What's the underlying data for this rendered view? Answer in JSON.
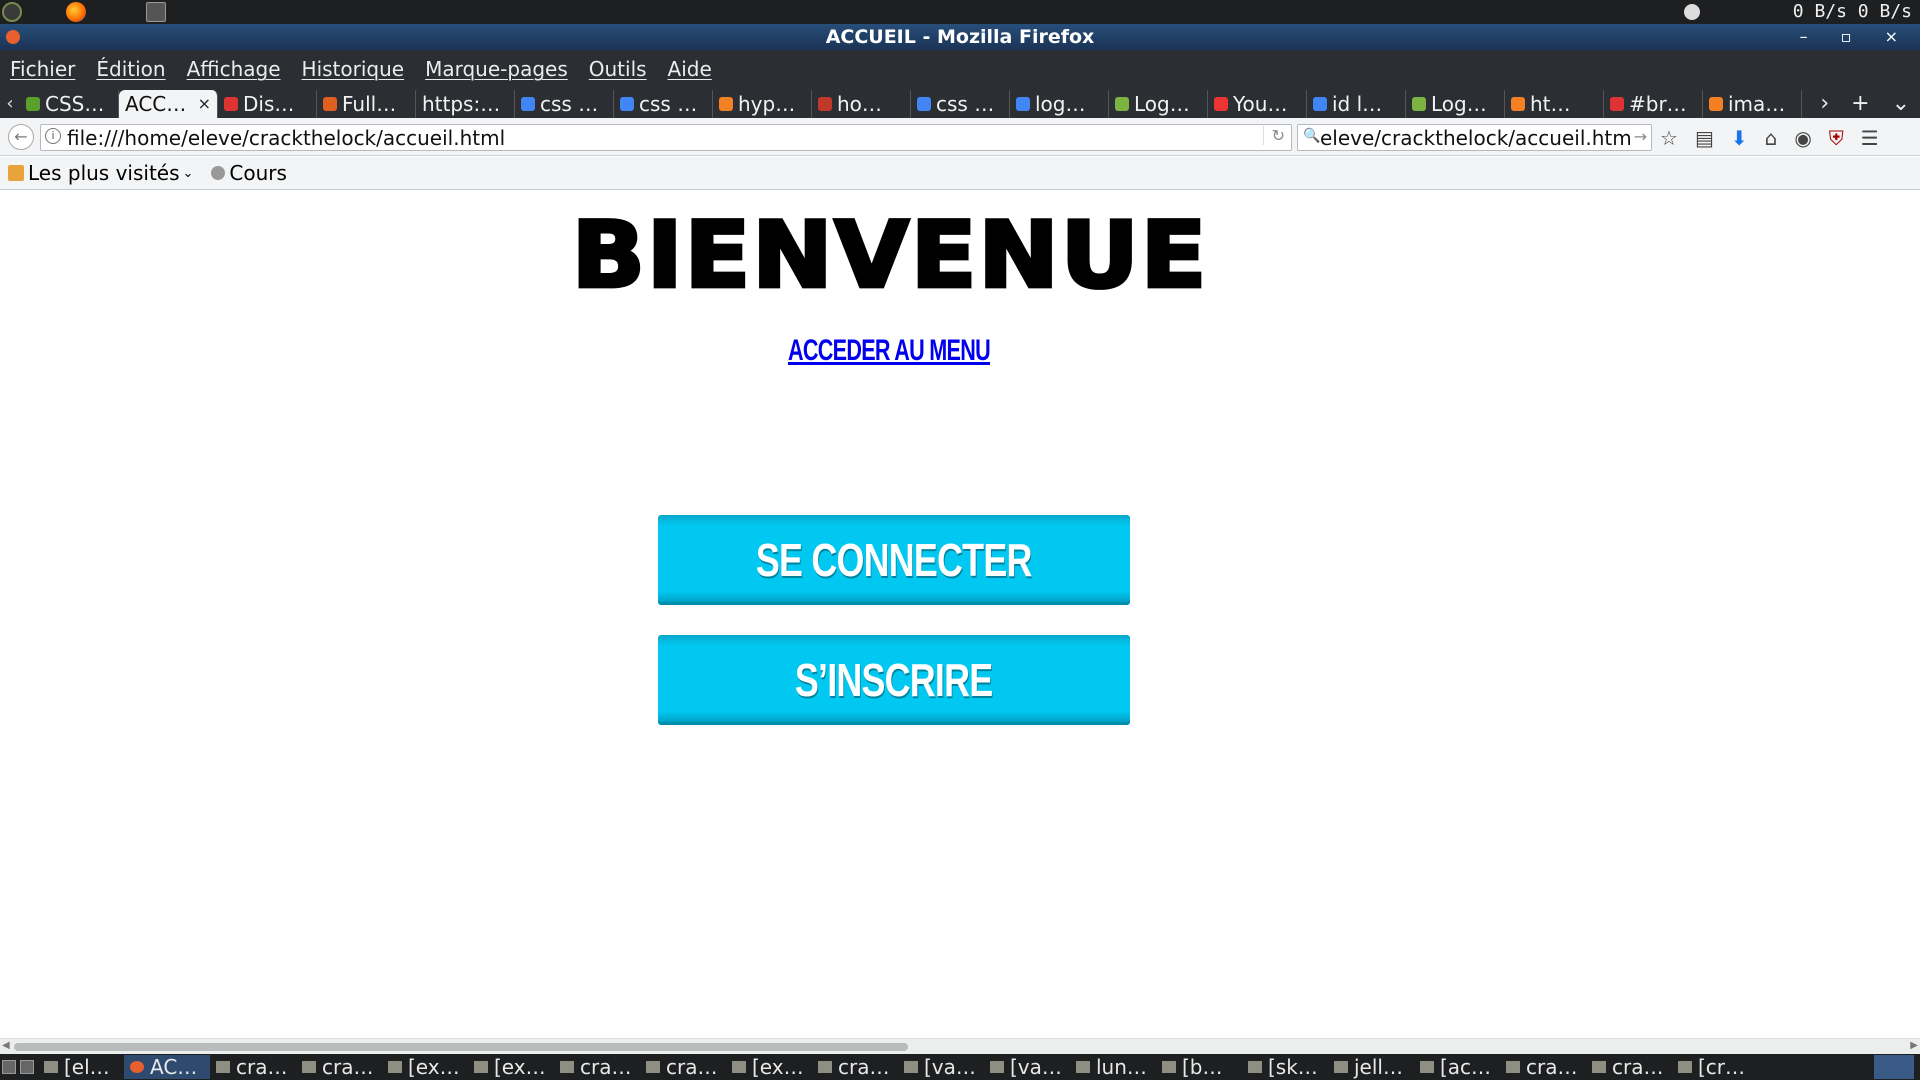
{
  "system_bar": {
    "tray_text": "0 B/s 0 B/s"
  },
  "window": {
    "title": "ACCUEIL - Mozilla Firefox",
    "controls": "– ▫ ×"
  },
  "menubar": {
    "items": [
      "Fichier",
      "Édition",
      "Affichage",
      "Historique",
      "Marque-pages",
      "Outils",
      "Aide"
    ]
  },
  "tabs": [
    {
      "label": "CSS…",
      "color": "#5aa02c",
      "active": false
    },
    {
      "label": "ACC…",
      "color": "",
      "active": true
    },
    {
      "label": "Dis…",
      "color": "#d33",
      "active": false
    },
    {
      "label": "Full…",
      "color": "#e06020",
      "active": false
    },
    {
      "label": "https:…",
      "color": "",
      "active": false
    },
    {
      "label": "css …",
      "color": "#4285f4",
      "active": false
    },
    {
      "label": "css …",
      "color": "#4285f4",
      "active": false
    },
    {
      "label": "hyp…",
      "color": "#f48024",
      "active": false
    },
    {
      "label": "ho…",
      "color": "#c0392b",
      "active": false
    },
    {
      "label": "css …",
      "color": "#4285f4",
      "active": false
    },
    {
      "label": "log…",
      "color": "#4285f4",
      "active": false
    },
    {
      "label": "Log…",
      "color": "#7cb342",
      "active": false
    },
    {
      "label": "You…",
      "color": "#e33",
      "active": false
    },
    {
      "label": "id l…",
      "color": "#4285f4",
      "active": false
    },
    {
      "label": "Log…",
      "color": "#7cb342",
      "active": false
    },
    {
      "label": "ht…",
      "color": "#f48024",
      "active": false
    },
    {
      "label": "#br…",
      "color": "#d33",
      "active": false
    },
    {
      "label": "ima…",
      "color": "#f48024",
      "active": false
    }
  ],
  "tab_close_glyph": "×",
  "tabbar_end": {
    "next": "›",
    "new_tab": "+",
    "list": "⌄"
  },
  "navbar": {
    "back_glyph": "←",
    "url": "file:///home/eleve/crackthelock/accueil.html",
    "search_value": "eleve/crackthelock/accueil.html",
    "reload_glyph": "↻",
    "go_glyph": "→",
    "icons": [
      "star-icon",
      "reader-icon",
      "download-icon",
      "home-icon",
      "pocket-icon",
      "ublock-icon",
      "hamburger-menu-icon"
    ]
  },
  "bookmarks": {
    "most_visited": "Les plus visités",
    "cours": "Cours"
  },
  "page": {
    "title": "BIENVENUE",
    "menu_link": "ACCEDER AU MENU",
    "login_button": "SE CONNECTER",
    "signup_button": "S’INSCRIRE"
  },
  "taskbar": {
    "items": [
      {
        "label": "[el…",
        "active": false
      },
      {
        "label": "AC…",
        "active": true
      },
      {
        "label": "cra…",
        "active": false
      },
      {
        "label": "cra…",
        "active": false
      },
      {
        "label": "[ex…",
        "active": false
      },
      {
        "label": "[ex…",
        "active": false
      },
      {
        "label": "cra…",
        "active": false
      },
      {
        "label": "cra…",
        "active": false
      },
      {
        "label": "[ex…",
        "active": false
      },
      {
        "label": "cra…",
        "active": false
      },
      {
        "label": "[va…",
        "active": false
      },
      {
        "label": "[va…",
        "active": false
      },
      {
        "label": "lun…",
        "active": false
      },
      {
        "label": "[b…",
        "active": false
      },
      {
        "label": "[sk…",
        "active": false
      },
      {
        "label": "jell…",
        "active": false
      },
      {
        "label": "[ac…",
        "active": false
      },
      {
        "label": "cra…",
        "active": false
      },
      {
        "label": "cra…",
        "active": false
      },
      {
        "label": "[cr…",
        "active": false
      }
    ]
  },
  "colors": {
    "button_bg": "#00c8f0",
    "link": "#0000ee"
  }
}
